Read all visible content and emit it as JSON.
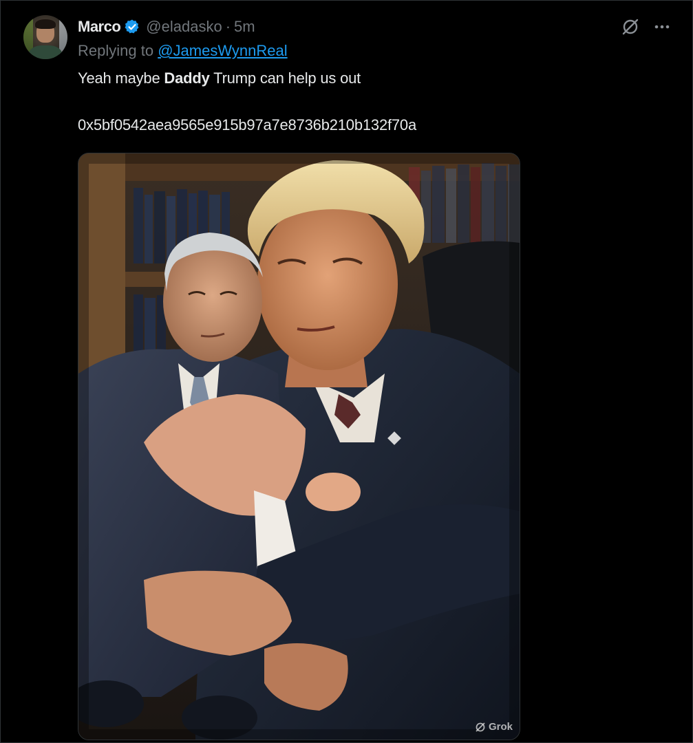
{
  "tweet": {
    "display_name": "Marco",
    "handle": "@eladasko",
    "separator": "·",
    "time": "5m",
    "replying_prefix": "Replying to",
    "replying_to": "@JamesWynnReal",
    "text_before_bold": "Yeah maybe ",
    "text_bold": "Daddy",
    "text_after_bold": " Trump can help us out",
    "wallet_address": "0x5bf0542aea9565e915b97a7e8736b210b132f70a"
  },
  "media": {
    "watermark_label": "Grok"
  },
  "icons": {
    "verified": "verified-badge-icon",
    "grok_action": "grok-icon",
    "more": "more-icon",
    "media_watermark": "grok-logo-icon"
  },
  "colors": {
    "background": "#000000",
    "text_primary": "#e7e9ea",
    "text_secondary": "#71767b",
    "link": "#1d9bf0",
    "verified": "#1d9bf0",
    "border": "#2f3336"
  }
}
